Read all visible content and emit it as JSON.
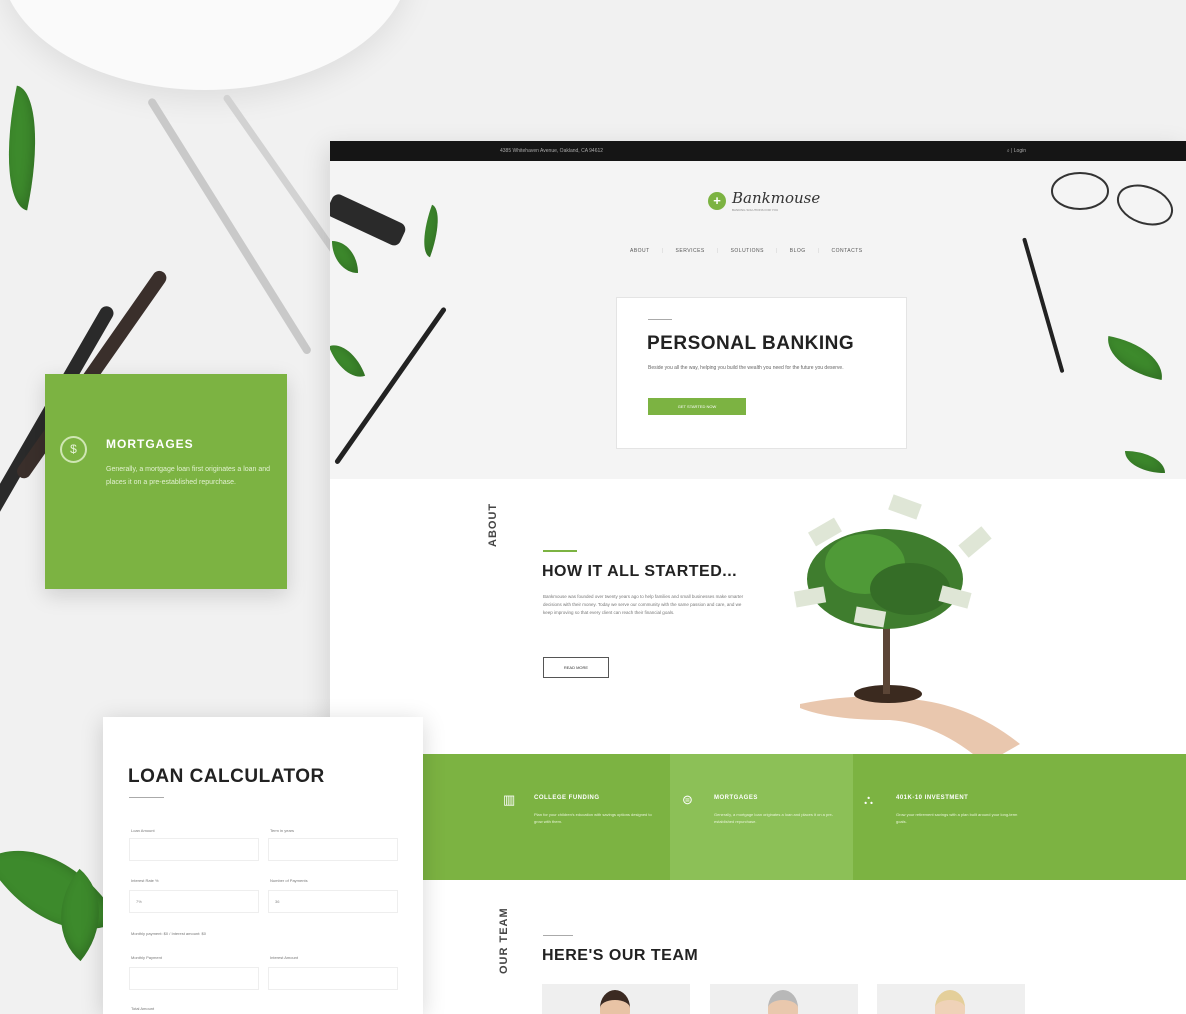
{
  "colors": {
    "accent": "#7cb342",
    "dark": "#151515",
    "feature_alt": "#8cc057"
  },
  "topbar": {
    "address": "4385 Whitehaven Avenue, Oakland, CA 94612",
    "tools": "⌕   |   Login"
  },
  "brand": {
    "name": "Bankmouse",
    "tagline": "BANKING SOLUTIONS FOR YOU"
  },
  "nav": {
    "items": [
      "ABOUT",
      "SERVICES",
      "SOLUTIONS",
      "BLOG",
      "CONTACTS"
    ]
  },
  "hero": {
    "title": "PERSONAL BANKING",
    "text": "Beside you all the way, helping you build the wealth you need for the future you deserve.",
    "cta": "GET STARTED NOW"
  },
  "about": {
    "side_label": "ABOUT",
    "title": "HOW IT ALL STARTED...",
    "text": "Bankmouse was founded over twenty years ago to help families and small businesses make smarter decisions with their money. Today we serve our community with the same passion and care, and we keep improving so that every client can reach their financial goals.",
    "more": "READ MORE"
  },
  "features": [
    {
      "icon": "bar-chart-icon",
      "title": "COLLEGE FUNDING",
      "text": "Plan for your children's education with savings options designed to grow with them."
    },
    {
      "icon": "dollar-icon",
      "title": "MORTGAGES",
      "text": "Generally, a mortgage loan originates a loan and places it on a pre-established repurchase."
    },
    {
      "icon": "network-icon",
      "title": "401K-10 INVESTMENT",
      "text": "Grow your retirement savings with a plan built around your long-term goals."
    }
  ],
  "team": {
    "side_label": "OUR TEAM",
    "title": "HERE'S OUR TEAM"
  },
  "loan": {
    "title": "LOAN CALCULATOR",
    "fields": [
      {
        "label": "Loan Amount",
        "value": ""
      },
      {
        "label": "Term in years",
        "value": ""
      },
      {
        "label": "Interest Rate %",
        "value": "7%"
      },
      {
        "label": "Number of Payments",
        "value": "36"
      },
      {
        "label": "Monthly Payment",
        "value": ""
      },
      {
        "label": "Interest Amount",
        "value": ""
      },
      {
        "label": "Total Amount",
        "value": ""
      }
    ],
    "note": "Monthly payment: $0 / Interest amount: $0"
  },
  "promo": {
    "icon": "dollar-icon",
    "title": "MORTGAGES",
    "text": "Generally, a mortgage loan first originates a loan and places it on a pre-established repurchase."
  }
}
